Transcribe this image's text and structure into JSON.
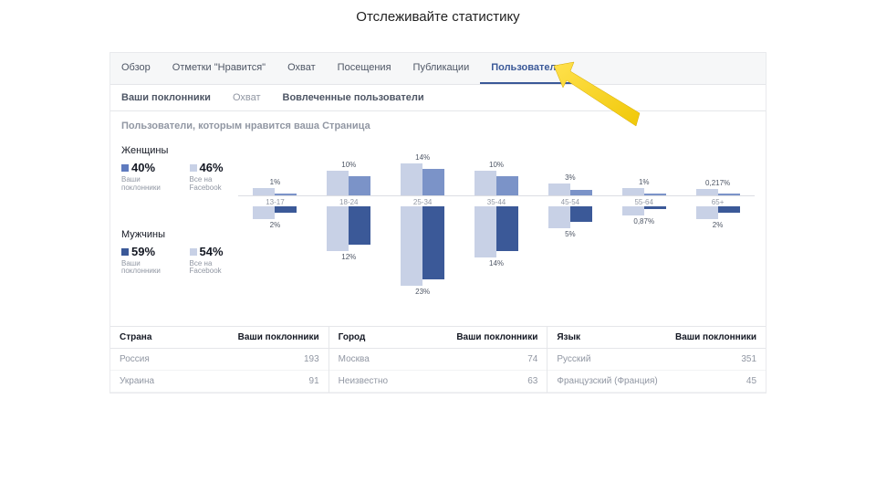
{
  "page_title": "Отслеживайте статистику",
  "main_tabs": [
    {
      "label": "Обзор",
      "active": false
    },
    {
      "label": "Отметки \"Нравится\"",
      "active": false
    },
    {
      "label": "Охват",
      "active": false
    },
    {
      "label": "Посещения",
      "active": false
    },
    {
      "label": "Публикации",
      "active": false
    },
    {
      "label": "Пользователи",
      "active": true
    }
  ],
  "sub_tabs": [
    {
      "label": "Ваши поклонники",
      "active": true
    },
    {
      "label": "Охват",
      "active": false
    },
    {
      "label": "Вовлеченные пользователи",
      "active": true
    }
  ],
  "section_heading": "Пользователи, которым нравится ваша Страница",
  "female": {
    "title": "Женщины",
    "fans_pct": "40%",
    "fans_label": "Ваши поклонники",
    "all_pct": "46%",
    "all_label": "Все на Facebook"
  },
  "male": {
    "title": "Мужчины",
    "fans_pct": "59%",
    "fans_label": "Ваши поклонники",
    "all_pct": "54%",
    "all_label": "Все на Facebook"
  },
  "age_labels": [
    "13-17",
    "18-24",
    "25-34",
    "35-44",
    "45-54",
    "55-64",
    "65+"
  ],
  "chart_data": {
    "type": "bar",
    "categories": [
      "13-17",
      "18-24",
      "25-34",
      "35-44",
      "45-54",
      "55-64",
      "65+"
    ],
    "female_fans_pct": [
      "1%",
      "10%",
      "14%",
      "10%",
      "3%",
      "1%",
      "0,217%"
    ],
    "male_fans_pct": [
      "2%",
      "12%",
      "23%",
      "14%",
      "5%",
      "0,87%",
      "2%"
    ],
    "series": [
      {
        "name": "Женщины — Ваши поклонники",
        "values": [
          1,
          10,
          14,
          10,
          3,
          1,
          0.217
        ]
      },
      {
        "name": "Мужчины — Ваши поклонники",
        "values": [
          2,
          12,
          23,
          14,
          5,
          0.87,
          2
        ]
      }
    ],
    "ylabel": "%"
  },
  "tables": {
    "country": {
      "head_label": "Страна",
      "head_val": "Ваши поклонники",
      "rows": [
        {
          "label": "Россия",
          "value": "193"
        },
        {
          "label": "Украина",
          "value": "91"
        }
      ]
    },
    "city": {
      "head_label": "Город",
      "head_val": "Ваши поклонники",
      "rows": [
        {
          "label": "Москва",
          "value": "74"
        },
        {
          "label": "Неизвестно",
          "value": "63"
        }
      ]
    },
    "language": {
      "head_label": "Язык",
      "head_val": "Ваши поклонники",
      "rows": [
        {
          "label": "Русский",
          "value": "351"
        },
        {
          "label": "Французский (Франция)",
          "value": "45"
        }
      ]
    }
  }
}
